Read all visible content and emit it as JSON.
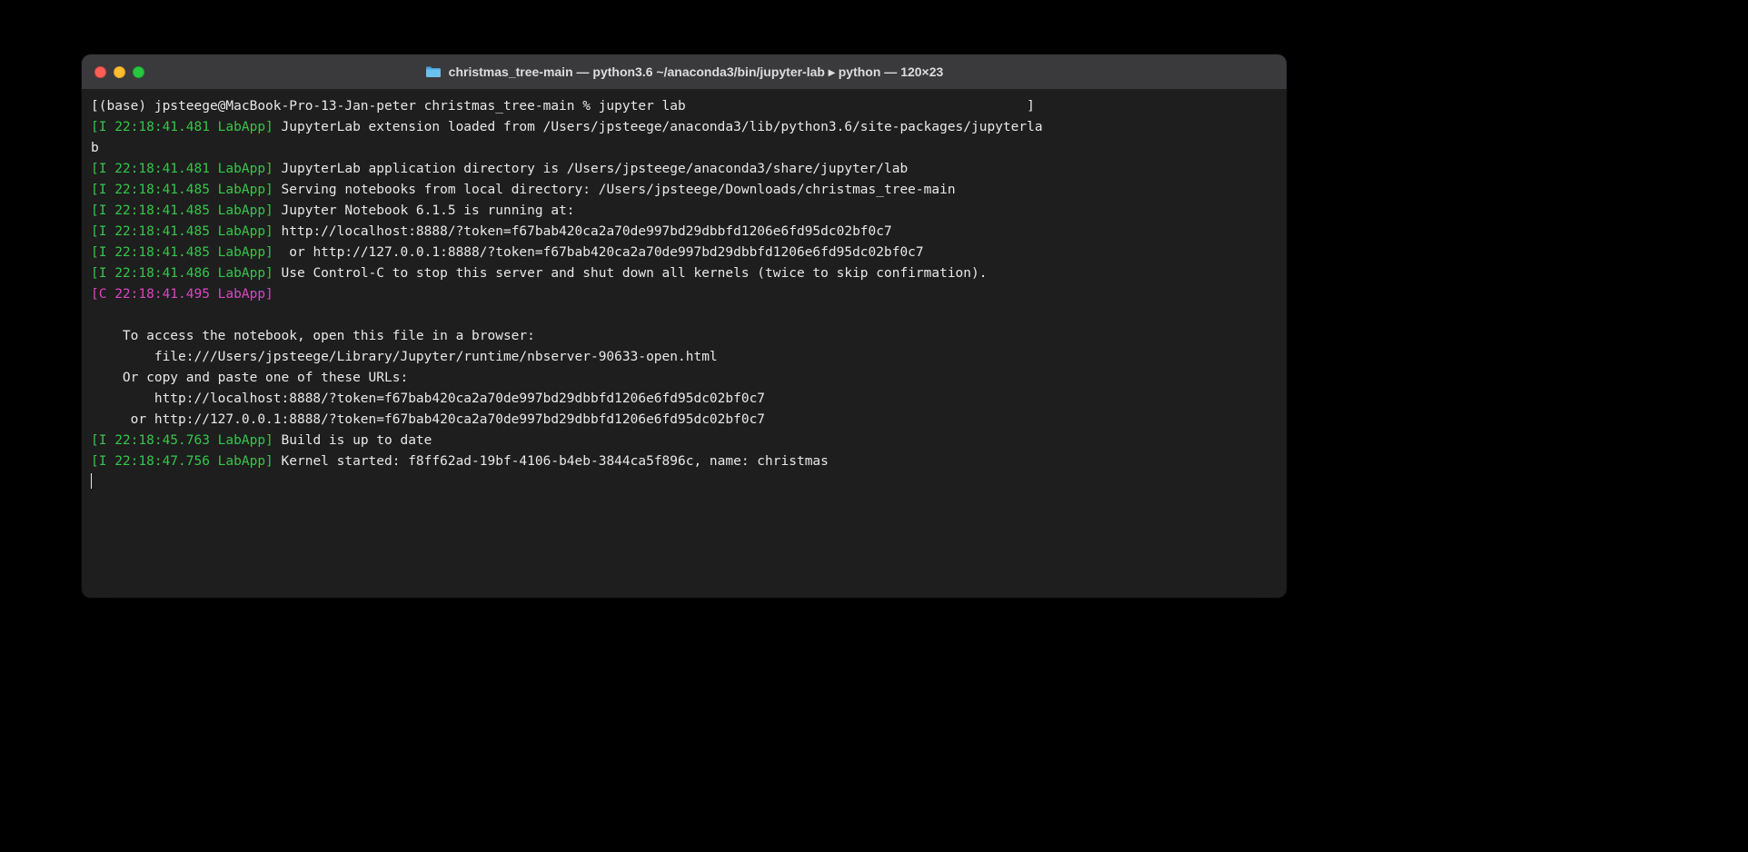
{
  "window": {
    "title": "christmas_tree-main — python3.6 ~/anaconda3/bin/jupyter-lab ▸ python — 120×23"
  },
  "lines": [
    {
      "segments": [
        {
          "cls": "",
          "text": "[(base) jpsteege@MacBook-Pro-13-Jan-peter christmas_tree-main % jupyter lab                                           ]"
        }
      ]
    },
    {
      "segments": [
        {
          "cls": "prefix-green",
          "text": "[I 22:18:41.481 LabApp]"
        },
        {
          "cls": "",
          "text": " JupyterLab extension loaded from /Users/jpsteege/anaconda3/lib/python3.6/site-packages/jupyterla"
        }
      ]
    },
    {
      "segments": [
        {
          "cls": "",
          "text": "b"
        }
      ]
    },
    {
      "segments": [
        {
          "cls": "prefix-green",
          "text": "[I 22:18:41.481 LabApp]"
        },
        {
          "cls": "",
          "text": " JupyterLab application directory is /Users/jpsteege/anaconda3/share/jupyter/lab"
        }
      ]
    },
    {
      "segments": [
        {
          "cls": "prefix-green",
          "text": "[I 22:18:41.485 LabApp]"
        },
        {
          "cls": "",
          "text": " Serving notebooks from local directory: /Users/jpsteege/Downloads/christmas_tree-main"
        }
      ]
    },
    {
      "segments": [
        {
          "cls": "prefix-green",
          "text": "[I 22:18:41.485 LabApp]"
        },
        {
          "cls": "",
          "text": " Jupyter Notebook 6.1.5 is running at:"
        }
      ]
    },
    {
      "segments": [
        {
          "cls": "prefix-green",
          "text": "[I 22:18:41.485 LabApp]"
        },
        {
          "cls": "",
          "text": " http://localhost:8888/?token=f67bab420ca2a70de997bd29dbbfd1206e6fd95dc02bf0c7"
        }
      ]
    },
    {
      "segments": [
        {
          "cls": "prefix-green",
          "text": "[I 22:18:41.485 LabApp]"
        },
        {
          "cls": "",
          "text": "  or http://127.0.0.1:8888/?token=f67bab420ca2a70de997bd29dbbfd1206e6fd95dc02bf0c7"
        }
      ]
    },
    {
      "segments": [
        {
          "cls": "prefix-green",
          "text": "[I 22:18:41.486 LabApp]"
        },
        {
          "cls": "",
          "text": " Use Control-C to stop this server and shut down all kernels (twice to skip confirmation)."
        }
      ]
    },
    {
      "segments": [
        {
          "cls": "prefix-magenta",
          "text": "[C 22:18:41.495 LabApp]"
        }
      ]
    },
    {
      "segments": [
        {
          "cls": "",
          "text": " "
        }
      ]
    },
    {
      "segments": [
        {
          "cls": "",
          "text": "    To access the notebook, open this file in a browser:"
        }
      ]
    },
    {
      "segments": [
        {
          "cls": "",
          "text": "        file:///Users/jpsteege/Library/Jupyter/runtime/nbserver-90633-open.html"
        }
      ]
    },
    {
      "segments": [
        {
          "cls": "",
          "text": "    Or copy and paste one of these URLs:"
        }
      ]
    },
    {
      "segments": [
        {
          "cls": "",
          "text": "        http://localhost:8888/?token=f67bab420ca2a70de997bd29dbbfd1206e6fd95dc02bf0c7"
        }
      ]
    },
    {
      "segments": [
        {
          "cls": "",
          "text": "     or http://127.0.0.1:8888/?token=f67bab420ca2a70de997bd29dbbfd1206e6fd95dc02bf0c7"
        }
      ]
    },
    {
      "segments": [
        {
          "cls": "prefix-green",
          "text": "[I 22:18:45.763 LabApp]"
        },
        {
          "cls": "",
          "text": " Build is up to date"
        }
      ]
    },
    {
      "segments": [
        {
          "cls": "prefix-green",
          "text": "[I 22:18:47.756 LabApp]"
        },
        {
          "cls": "",
          "text": " Kernel started: f8ff62ad-19bf-4106-b4eb-3844ca5f896c, name: christmas"
        }
      ]
    }
  ]
}
